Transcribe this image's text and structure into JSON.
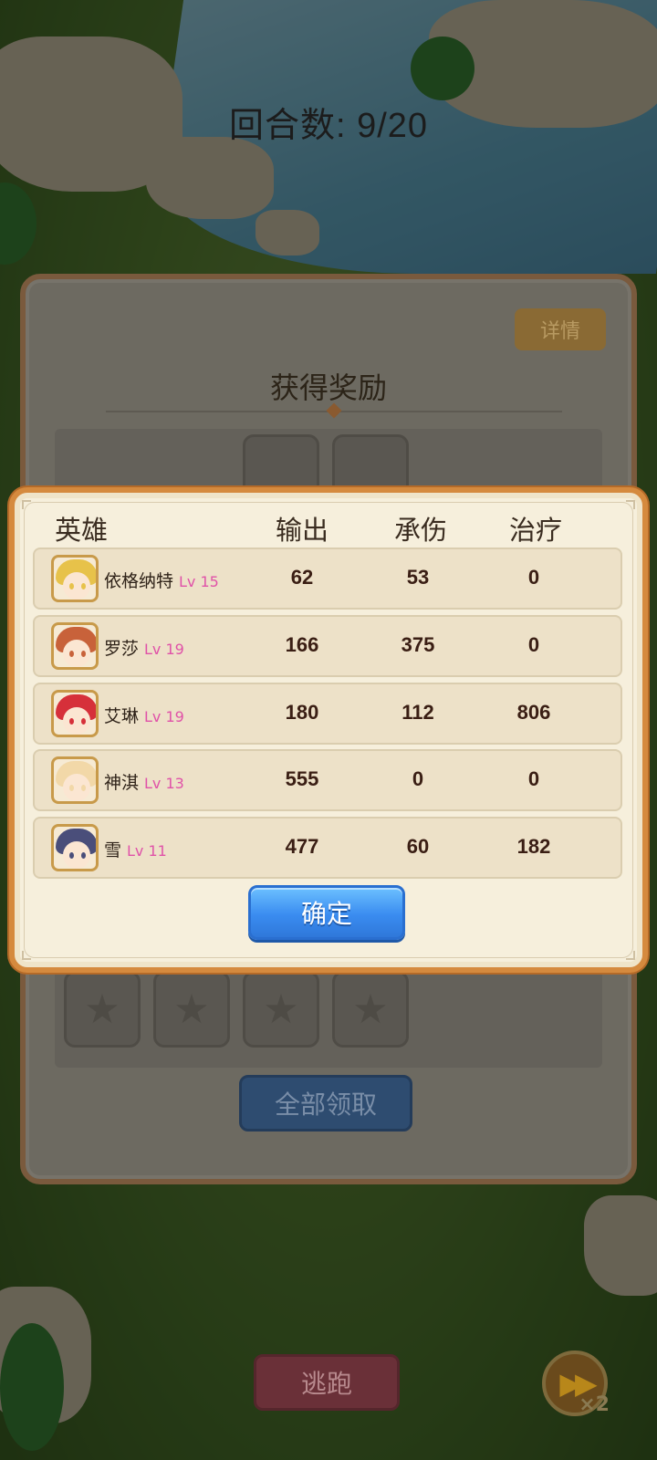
{
  "round_counter": {
    "label": "回合数: ",
    "value": "9/20"
  },
  "reward_panel": {
    "detail_label": "详情",
    "title": "获得奖励",
    "collect_all_label": "全部领取"
  },
  "stats": {
    "headers": {
      "hero": "英雄",
      "damage": "输出",
      "tank": "承伤",
      "heal": "治疗"
    },
    "heroes": [
      {
        "name": "依格纳特",
        "level": "Lv 15",
        "damage": "62",
        "tank": "53",
        "heal": "0",
        "hair_color": "#e7c24a"
      },
      {
        "name": "罗莎",
        "level": "Lv 19",
        "damage": "166",
        "tank": "375",
        "heal": "0",
        "hair_color": "#c8623a"
      },
      {
        "name": "艾琳",
        "level": "Lv 19",
        "damage": "180",
        "tank": "112",
        "heal": "806",
        "hair_color": "#d6303a"
      },
      {
        "name": "神淇",
        "level": "Lv 13",
        "damage": "555",
        "tank": "0",
        "heal": "0",
        "hair_color": "#f2d8a8"
      },
      {
        "name": "雪",
        "level": "Lv 11",
        "damage": "477",
        "tank": "60",
        "heal": "182",
        "hair_color": "#4a4e7a"
      }
    ],
    "confirm_label": "确定"
  },
  "bottom": {
    "escape_label": "逃跑",
    "speed_label": "×2"
  },
  "colors": {
    "modal_border": "#d58a3e",
    "level_text": "#e052a8",
    "confirm_button": "#3a8cf0"
  }
}
